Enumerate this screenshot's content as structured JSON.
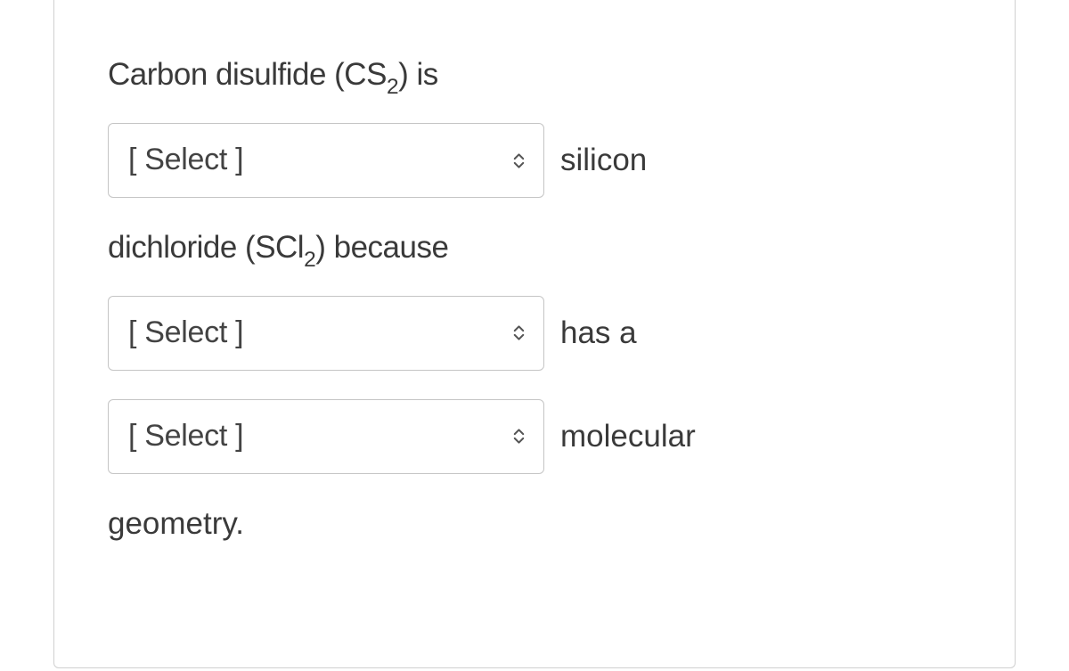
{
  "question": {
    "line1_pre": "Carbon disulfide (CS",
    "line1_sub": "2",
    "line1_post": ") is",
    "select1": {
      "placeholder": "[ Select ]"
    },
    "after_select1": "silicon",
    "line2_pre": "dichloride (SCl",
    "line2_sub": "2",
    "line2_post": ") because",
    "select2": {
      "placeholder": "[ Select ]"
    },
    "after_select2": "has a",
    "select3": {
      "placeholder": "[ Select ]"
    },
    "after_select3": "molecular",
    "final": "geometry."
  }
}
